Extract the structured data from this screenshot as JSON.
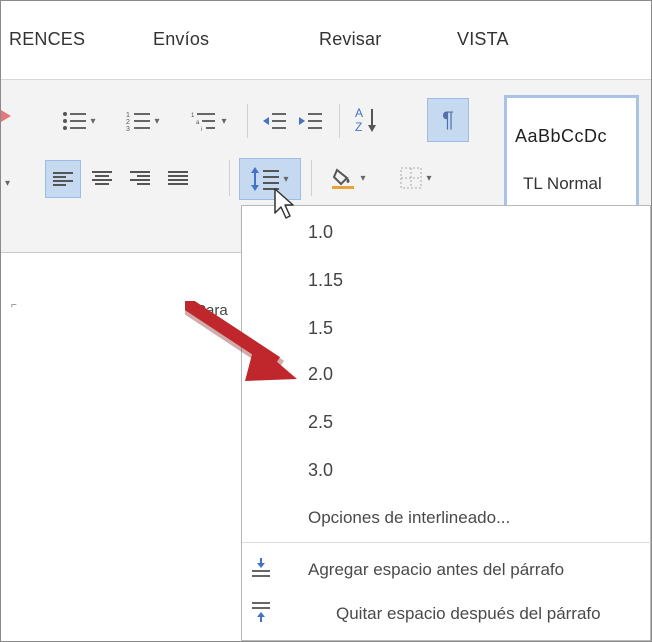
{
  "tabs": [
    "RENCES",
    "Envíos",
    "Revisar",
    "VISTA"
  ],
  "style_gallery": {
    "preview": "AaBbCcDc",
    "name": "TL Normal"
  },
  "group_label": "Para",
  "line_spacing_menu": {
    "options": [
      "1.0",
      "1.15",
      "1.5",
      "2.0",
      "2.5",
      "3.0"
    ],
    "line_spacing_options": "Opciones de interlineado...",
    "add_space_before": "Agregar espacio antes del párrafo",
    "remove_space_after": "Quitar espacio después del párrafo"
  },
  "colors": {
    "selected_button": "#c5d9f1",
    "arrow": "#c0272d"
  },
  "icons": {
    "pilcrow": "¶"
  }
}
